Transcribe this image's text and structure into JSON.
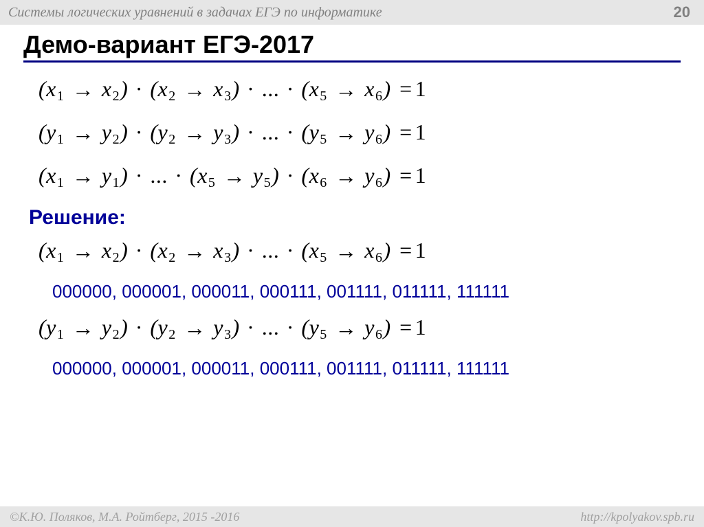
{
  "header": {
    "topic": "Системы логических уравнений в задачах ЕГЭ по информатике",
    "page": "20"
  },
  "title": "Демо-вариант ЕГЭ-2017",
  "equations": {
    "eq1": {
      "terms": [
        {
          "v": "x",
          "a": "1",
          "b": "2"
        },
        {
          "v": "x",
          "a": "2",
          "b": "3"
        }
      ],
      "ell": "...",
      "last": {
        "v": "x",
        "a": "5",
        "b": "6"
      },
      "rhs": "1"
    },
    "eq2": {
      "terms": [
        {
          "v": "y",
          "a": "1",
          "b": "2"
        },
        {
          "v": "y",
          "a": "2",
          "b": "3"
        }
      ],
      "ell": "...",
      "last": {
        "v": "y",
        "a": "5",
        "b": "6"
      },
      "rhs": "1"
    },
    "eq3": {
      "first": {
        "va": "x",
        "a": "1",
        "vb": "y",
        "b": "1"
      },
      "ell": "...",
      "mid": {
        "va": "x",
        "a": "5",
        "vb": "y",
        "b": "5"
      },
      "last": {
        "va": "x",
        "a": "6",
        "vb": "y",
        "b": "6"
      },
      "rhs": "1"
    }
  },
  "solution": {
    "label": "Решение:",
    "eq4": {
      "terms": [
        {
          "v": "x",
          "a": "1",
          "b": "2"
        },
        {
          "v": "x",
          "a": "2",
          "b": "3"
        }
      ],
      "ell": "...",
      "last": {
        "v": "x",
        "a": "5",
        "b": "6"
      },
      "rhs": "1"
    },
    "seq1": "000000, 000001, 000011, 000111, 001111, 011111, 111111",
    "eq5": {
      "terms": [
        {
          "v": "y",
          "a": "1",
          "b": "2"
        },
        {
          "v": "y",
          "a": "2",
          "b": "3"
        }
      ],
      "ell": "...",
      "last": {
        "v": "y",
        "a": "5",
        "b": "6"
      },
      "rhs": "1"
    },
    "seq2": "000000, 000001, 000011, 000111, 001111, 011111, 111111"
  },
  "footer": {
    "copyright": "©К.Ю. Поляков, М.А. Ройтберг, 2015 -2016",
    "url": "http://kpolyakov.spb.ru"
  },
  "glyphs": {
    "arrow": "→",
    "dot": "·",
    "eq": "="
  }
}
